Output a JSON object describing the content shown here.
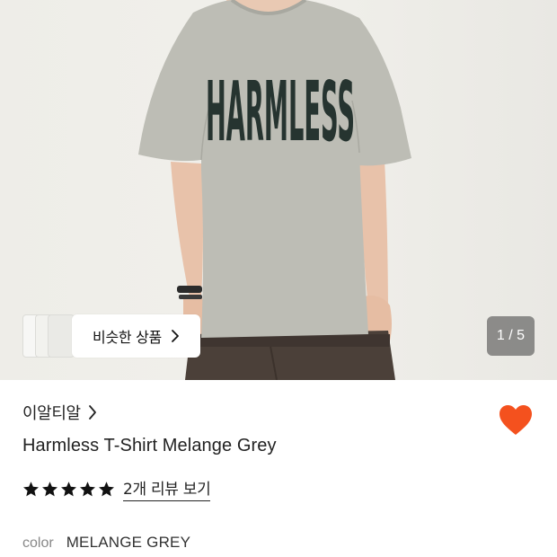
{
  "gallery": {
    "shirt_print": "HARMLESS",
    "counter": "1 / 5",
    "similar_label": "비슷한 상품"
  },
  "product": {
    "brand": "이알티알",
    "title": "Harmless T-Shirt Melange Grey",
    "rating_stars": 5,
    "review_link": "2개 리뷰 보기",
    "option_label": "color",
    "option_value": "MELANGE GREY",
    "favorited": true
  },
  "colors": {
    "heart": "#f4511e",
    "star": "#111111",
    "counter_bg": "#555555"
  }
}
